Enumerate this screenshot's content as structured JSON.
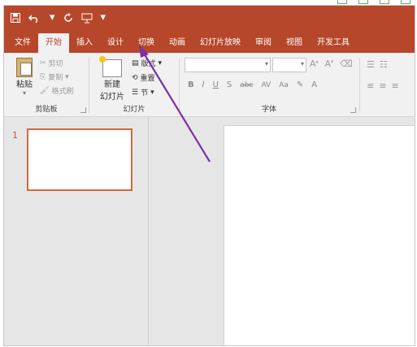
{
  "quick_access": {
    "save_icon": "save-icon",
    "undo_icon": "undo-icon",
    "redo_icon": "redo-icon",
    "present_icon": "present-icon",
    "more": "▾"
  },
  "tabs": [
    {
      "label": "文件"
    },
    {
      "label": "开始"
    },
    {
      "label": "插入"
    },
    {
      "label": "设计"
    },
    {
      "label": "切换"
    },
    {
      "label": "动画"
    },
    {
      "label": "幻灯片放映"
    },
    {
      "label": "审阅"
    },
    {
      "label": "视图"
    },
    {
      "label": "开发工具"
    }
  ],
  "ribbon": {
    "clipboard": {
      "paste": "粘贴",
      "cut": "剪切",
      "copy": "复制",
      "format_painter": "格式刷",
      "group_label": "剪贴板"
    },
    "slides": {
      "new_slide_line1": "新建",
      "new_slide_line2": "幻灯片",
      "layout": "版式",
      "reset": "重置",
      "section": "节",
      "group_label": "幻灯片"
    },
    "font": {
      "font_name": "",
      "font_size": "",
      "bold": "B",
      "italic": "I",
      "underline": "U",
      "shadow": "S",
      "strike": "abc",
      "spacing": "AV",
      "case": "Aa",
      "group_label": "字体"
    }
  },
  "slides_pane": {
    "slide_number": "1"
  }
}
